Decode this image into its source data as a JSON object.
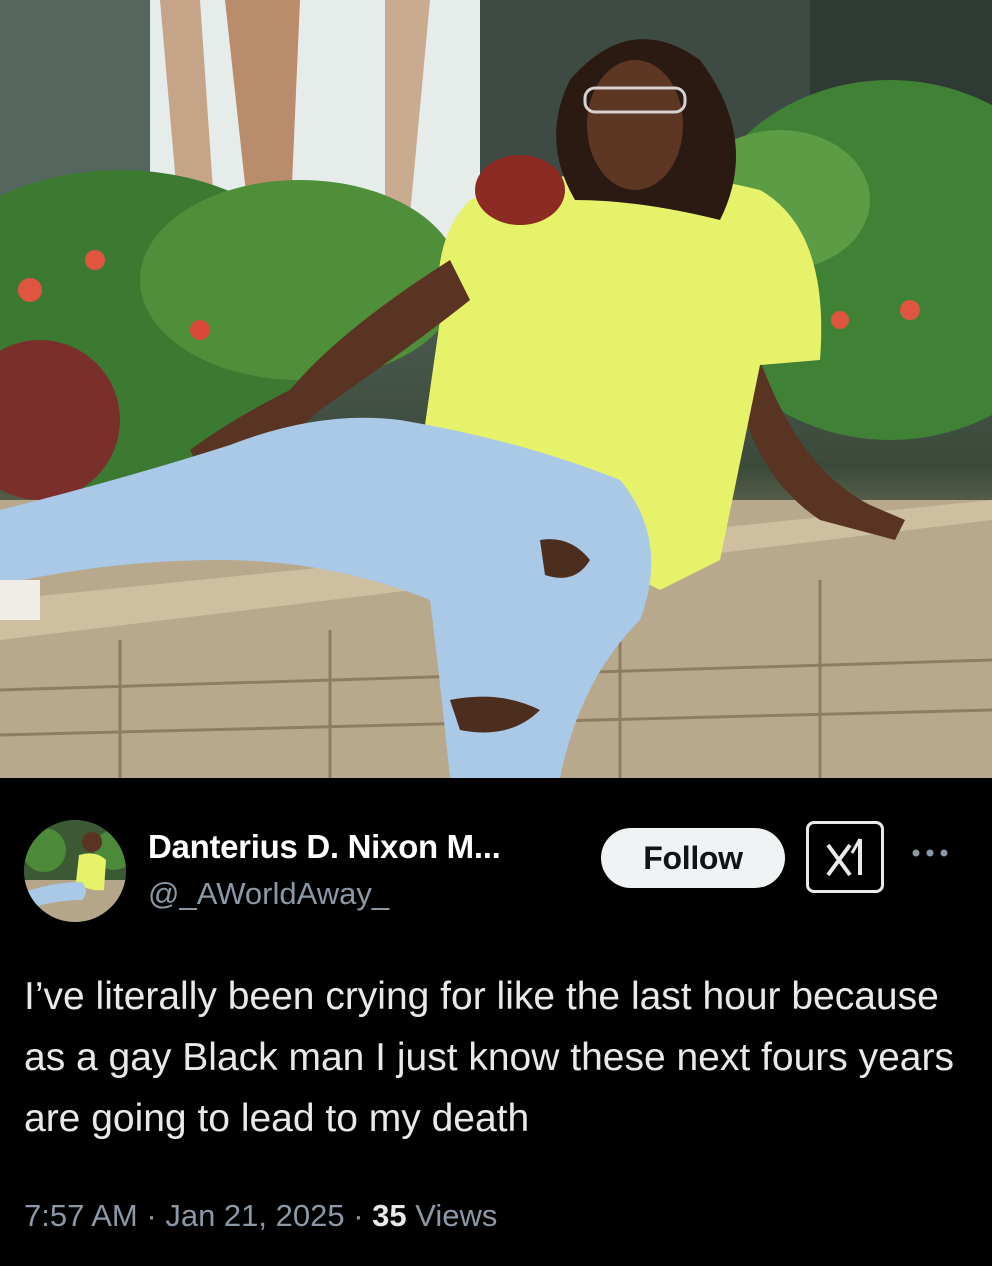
{
  "photo": {
    "description_icon": "photo-image",
    "shirt_color": "#e6f26a",
    "jeans_color": "#a9c9e6"
  },
  "author": {
    "display_name": "Danterius D. Nixon M...",
    "handle": "@_AWorldAway_",
    "avatar_icon": "avatar-image"
  },
  "actions": {
    "follow_label": "Follow",
    "grok_icon": "grok-icon",
    "more_icon": "more-dots-icon"
  },
  "tweet": {
    "text": "I’ve literally been crying for like the last hour because as a gay Black man I just know these next fours years are going to lead to my death"
  },
  "meta": {
    "time": "7:57 AM",
    "separator": "·",
    "date": "Jan 21, 2025",
    "views_count": "35",
    "views_label": "Views"
  },
  "colors": {
    "background": "#000000",
    "primary_text": "#e7e9ea",
    "secondary_text": "#8b98a5",
    "follow_bg": "#eff3f4"
  }
}
